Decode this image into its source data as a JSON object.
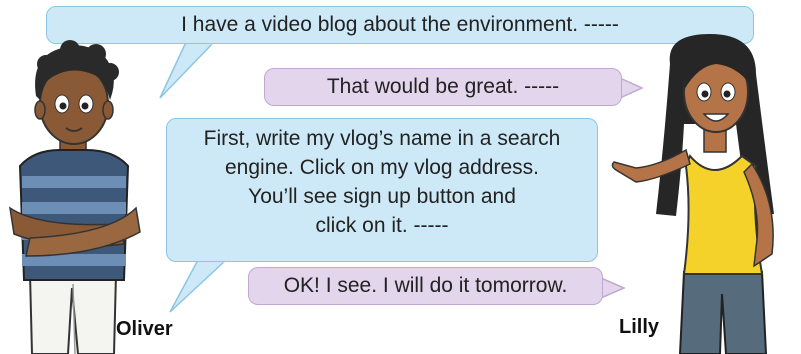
{
  "dialogue": [
    {
      "speaker": "Oliver",
      "text": "I have a video blog about the environment. -----"
    },
    {
      "speaker": "Lilly",
      "text": "That would be great. -----"
    },
    {
      "speaker": "Oliver",
      "lines": [
        "First, write my vlog’s name in a search",
        "engine. Click on my vlog address.",
        "You’ll see sign up button and",
        "click on it. -----"
      ]
    },
    {
      "speaker": "Lilly",
      "text": "OK! I see. I will do it tomorrow."
    }
  ],
  "characters": {
    "oliver": {
      "name": "Oliver"
    },
    "lilly": {
      "name": "Lilly"
    }
  },
  "colors": {
    "oliver_bubble": "#cde9f7",
    "lilly_bubble": "#e3d6ec"
  }
}
